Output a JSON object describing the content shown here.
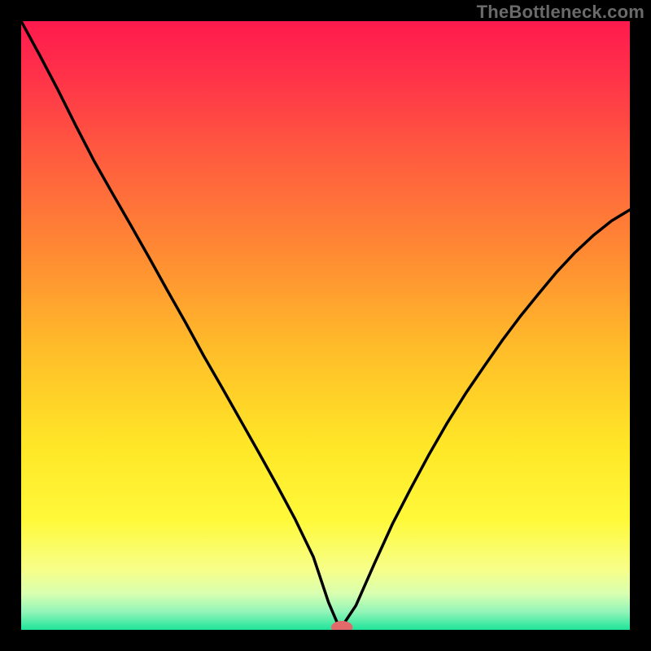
{
  "watermark": "TheBottleneck.com",
  "colors": {
    "frame": "#000000",
    "curve": "#000000",
    "marker_fill": "#e36a6a",
    "marker_stroke": "#e36a6a",
    "gradient_stops": [
      {
        "offset": 0,
        "color": "#ff1a4d"
      },
      {
        "offset": 0.08,
        "color": "#ff2f4a"
      },
      {
        "offset": 0.22,
        "color": "#ff5b3f"
      },
      {
        "offset": 0.38,
        "color": "#ff8a33"
      },
      {
        "offset": 0.55,
        "color": "#ffc029"
      },
      {
        "offset": 0.7,
        "color": "#ffe727"
      },
      {
        "offset": 0.82,
        "color": "#fff93a"
      },
      {
        "offset": 0.9,
        "color": "#f7ff88"
      },
      {
        "offset": 0.94,
        "color": "#d9ffb0"
      },
      {
        "offset": 0.97,
        "color": "#93f5b8"
      },
      {
        "offset": 1.0,
        "color": "#1fe49a"
      }
    ]
  },
  "chart_data": {
    "type": "line",
    "x": [
      0.0,
      0.03,
      0.06,
      0.09,
      0.12,
      0.15,
      0.18,
      0.21,
      0.24,
      0.27,
      0.3,
      0.33,
      0.36,
      0.39,
      0.42,
      0.45,
      0.48,
      0.505,
      0.52,
      0.53,
      0.55,
      0.58,
      0.61,
      0.64,
      0.67,
      0.7,
      0.73,
      0.76,
      0.79,
      0.82,
      0.85,
      0.88,
      0.91,
      0.94,
      0.97,
      1.0
    ],
    "values": [
      1.0,
      0.945,
      0.888,
      0.828,
      0.77,
      0.717,
      0.665,
      0.612,
      0.558,
      0.505,
      0.45,
      0.398,
      0.345,
      0.292,
      0.238,
      0.182,
      0.12,
      0.045,
      0.01,
      0.01,
      0.04,
      0.108,
      0.174,
      0.232,
      0.288,
      0.34,
      0.388,
      0.432,
      0.475,
      0.515,
      0.552,
      0.588,
      0.62,
      0.648,
      0.672,
      0.69
    ],
    "xlabel": "",
    "ylabel": "",
    "xlim": [
      0,
      1
    ],
    "ylim": [
      0,
      1
    ],
    "title": "",
    "marker": {
      "x": 0.527,
      "y": 0.004,
      "rx": 0.017,
      "ry": 0.01
    }
  }
}
